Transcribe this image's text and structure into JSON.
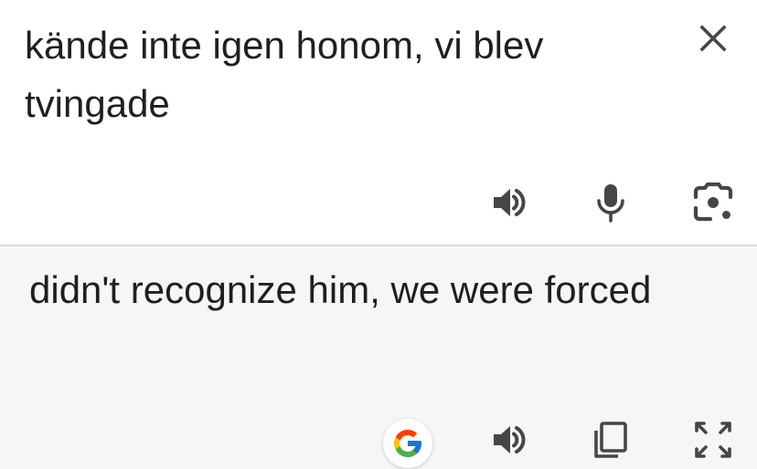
{
  "source": {
    "text": "kände inte igen honom, vi blev tvingade",
    "close_icon": "close-icon",
    "listen_icon": "speaker-icon",
    "mic_icon": "microphone-icon",
    "camera_icon": "camera-lens-icon"
  },
  "result": {
    "text": "didn't recognize him, we were forced",
    "google_icon": "google-g-icon",
    "listen_icon": "speaker-icon",
    "copy_icon": "copy-icon",
    "fullscreen_icon": "fullscreen-icon"
  },
  "colors": {
    "icon": "#444746",
    "text": "#1f1f1f",
    "result_bg": "#f5f6f8",
    "divider": "#dadce0",
    "google_blue": "#4285F4",
    "google_red": "#EA4335",
    "google_yellow": "#FBBC05",
    "google_green": "#34A853"
  }
}
